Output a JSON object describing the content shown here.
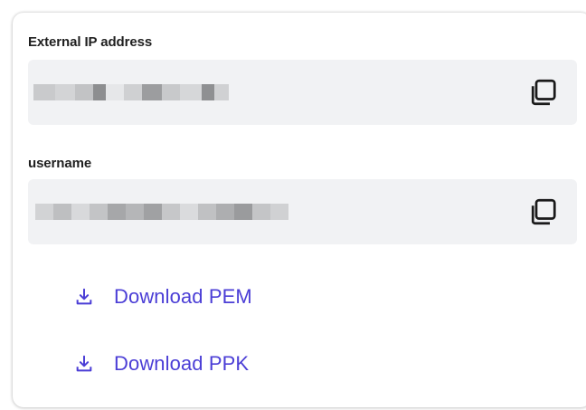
{
  "card": {
    "fields": [
      {
        "label": "External IP address",
        "value": ""
      },
      {
        "label": "username",
        "value": ""
      }
    ]
  },
  "actions": {
    "download_pem": "Download PEM",
    "download_ppk": "Download PPK"
  },
  "icons": {
    "copy": "copy-icon",
    "download": "download-icon"
  },
  "colors": {
    "accent": "#4b3ed6",
    "field_bg": "#f1f2f4",
    "text": "#1f1f1f"
  }
}
